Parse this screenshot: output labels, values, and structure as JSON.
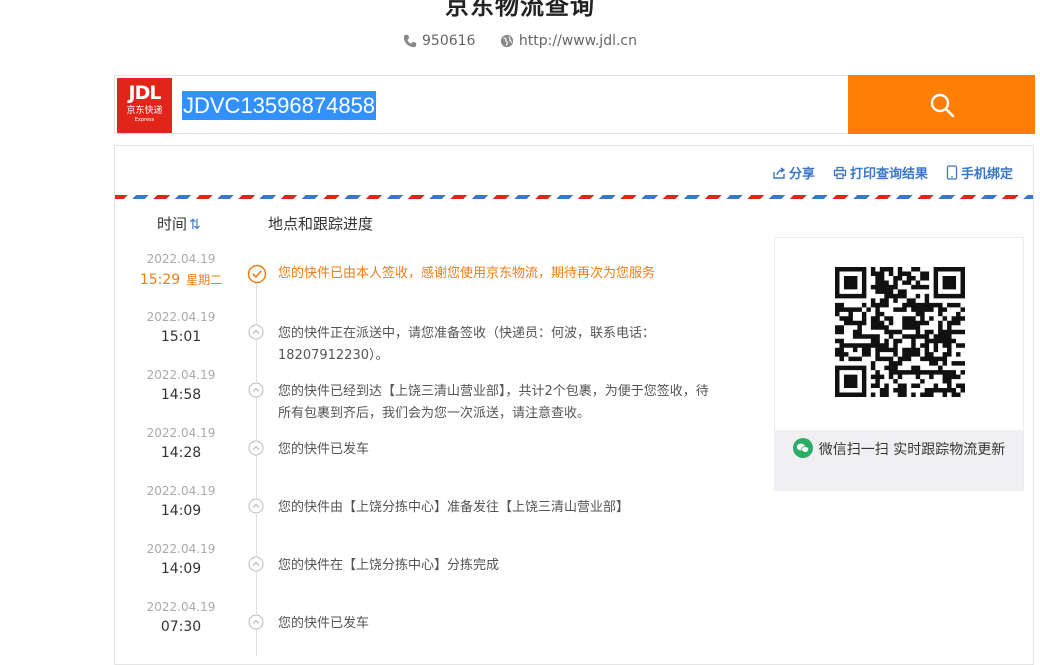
{
  "header": {
    "title": "京东物流查询",
    "phone": "950616",
    "website": "http://www.jdl.cn"
  },
  "search": {
    "logo_main": "JDL",
    "logo_sub": "京东快递",
    "logo_small": "Express",
    "tracking_number": "JDVC13596874858"
  },
  "actions": {
    "share": "分享",
    "print": "打印查询结果",
    "bind_phone": "手机绑定"
  },
  "columns": {
    "time": "时间",
    "progress": "地点和跟踪进度"
  },
  "entries": [
    {
      "date": "2022.04.19",
      "time": "15:29",
      "weekday": "星期二",
      "message": "您的快件已由本人签收，感谢您使用京东物流，期待再次为您服务"
    },
    {
      "date": "2022.04.19",
      "time": "15:01",
      "message": "您的快件正在派送中，请您准备签收（快递员：何波，联系电话：18207912230）。"
    },
    {
      "date": "2022.04.19",
      "time": "14:58",
      "message": "您的快件已经到达【上饶三清山营业部】，共计2个包裹，为便于您签收，待所有包裹到齐后，我们会为您一次派送，请注意查收。"
    },
    {
      "date": "2022.04.19",
      "time": "14:28",
      "message": "您的快件已发车"
    },
    {
      "date": "2022.04.19",
      "time": "14:09",
      "message": "您的快件由【上饶分拣中心】准备发往【上饶三清山营业部】"
    },
    {
      "date": "2022.04.19",
      "time": "14:09",
      "message": "您的快件在【上饶分拣中心】分拣完成"
    },
    {
      "date": "2022.04.19",
      "time": "07:30",
      "message": "您的快件已发车"
    }
  ],
  "qr": {
    "caption": "微信扫一扫 实时跟踪物流更新"
  },
  "colors": {
    "brand_red": "#e1251b",
    "accent_orange": "#ff7e05",
    "link_blue": "#3b77c7",
    "latest_orange": "#f17c15"
  }
}
